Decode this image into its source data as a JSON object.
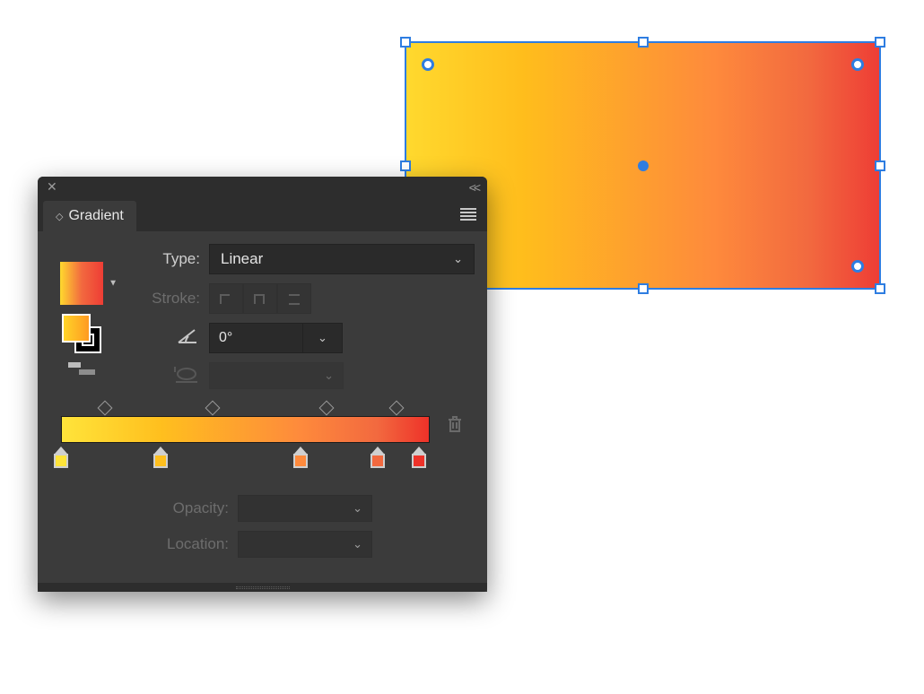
{
  "panel": {
    "title": "Gradient",
    "type_label": "Type:",
    "type_value": "Linear",
    "stroke_label": "Stroke:",
    "angle_value": "0°",
    "opacity_label": "Opacity:",
    "location_label": "Location:"
  },
  "gradient": {
    "midpoints_pct": [
      12,
      41,
      72,
      91
    ],
    "stops": [
      {
        "pct": 0,
        "color": "#ffe43a"
      },
      {
        "pct": 27,
        "color": "#ffbf1e"
      },
      {
        "pct": 65,
        "color": "#fe8a3c"
      },
      {
        "pct": 86,
        "color": "#f2693f"
      },
      {
        "pct": 97,
        "color": "#ee3229"
      }
    ]
  },
  "shape": {
    "fill": "linear-gradient(to right,#ffd92e 0%,#ffbd1c 25%,#fe8a3c 65%,#f2693f 85%,#ee3d35 100%)"
  }
}
